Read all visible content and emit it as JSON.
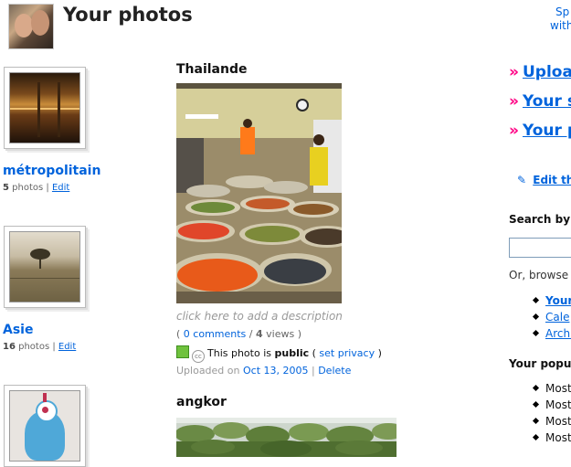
{
  "header": {
    "title": "Your photos",
    "corner_line1": "Sp",
    "corner_line2": "with"
  },
  "sets": [
    {
      "title": "métropolitain",
      "count": "5",
      "count_suffix": " photos | ",
      "edit": "Edit"
    },
    {
      "title": "Asie",
      "count": "16",
      "count_suffix": " photos | ",
      "edit": "Edit"
    },
    {
      "title": "",
      "count": "",
      "count_suffix": "",
      "edit": ""
    }
  ],
  "photos": [
    {
      "title": "Thailande",
      "description_hint": "click here to add a description",
      "comments_prefix": "( ",
      "comments_link": "0 comments",
      "views_sep": " / ",
      "views_count": "4",
      "views_suffix": " views )",
      "privacy_prefix": "This photo is ",
      "privacy_value": "public",
      "privacy_open": " ( ",
      "privacy_link": "set privacy",
      "privacy_close": " )",
      "uploaded_prefix": "Uploaded on ",
      "uploaded_date": "Oct 13, 2005",
      "uploaded_sep": " | ",
      "delete_label": "Delete",
      "cc_icon_text": "cc"
    },
    {
      "title": "angkor"
    }
  ],
  "right": {
    "big_links": [
      "Upload",
      "Your s",
      "Your p"
    ],
    "raquo": "»",
    "edit_link": "Edit the",
    "search_heading": "Search by ta",
    "browse_text": "Or, browse b",
    "browse_items": [
      "Your",
      "Cale",
      "Archi"
    ],
    "popular_heading": "Your popula",
    "popular_items": [
      "Most",
      "Most",
      "Most",
      "Most"
    ]
  },
  "colors": {
    "link": "#0063dc",
    "accent": "#ff0084",
    "public_icon": "#6fc23d"
  }
}
